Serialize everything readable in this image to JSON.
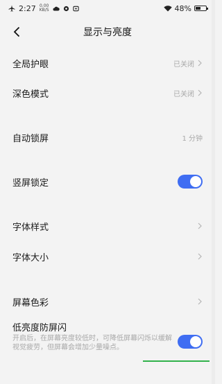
{
  "status_bar": {
    "time": "2:27",
    "net_speed_top": "0.00",
    "net_speed_bottom": "KB/S",
    "battery": "48%"
  },
  "header": {
    "title": "显示与亮度"
  },
  "settings": [
    {
      "label": "全局护眼",
      "value": "已关闭",
      "control": "chevron"
    },
    {
      "label": "深色模式",
      "value": "已关闭",
      "control": "chevron"
    },
    {
      "label": "自动锁屏",
      "value": "1 分钟",
      "control": "none"
    },
    {
      "label": "竖屏锁定",
      "value": "",
      "control": "toggle",
      "on": true
    },
    {
      "label": "字体样式",
      "value": "",
      "control": "chevron"
    },
    {
      "label": "字体大小",
      "value": "",
      "control": "chevron"
    },
    {
      "label": "屏幕色彩",
      "value": "",
      "control": "chevron"
    },
    {
      "label": "低亮度防屏闪",
      "value": "",
      "control": "toggle",
      "on": true
    }
  ],
  "low_brightness_desc": "开启后，在屏幕亮度较低时，可降低屏幕闪烁以缓解视觉疲劳，但屏幕会增加少量噪点。",
  "colors": {
    "accent": "#3f6df2",
    "gesture": "#30b24a",
    "background": "#f3f3f3"
  }
}
